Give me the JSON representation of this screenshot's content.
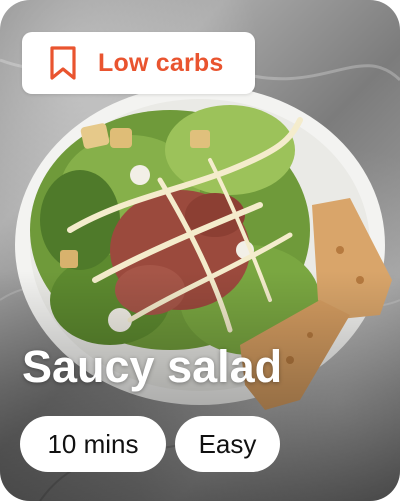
{
  "badge": {
    "label": "Low carbs",
    "icon": "bookmark-icon",
    "color": "#e9542f"
  },
  "recipe": {
    "title": "Saucy salad"
  },
  "meta": {
    "time": "10 mins",
    "difficulty": "Easy"
  }
}
